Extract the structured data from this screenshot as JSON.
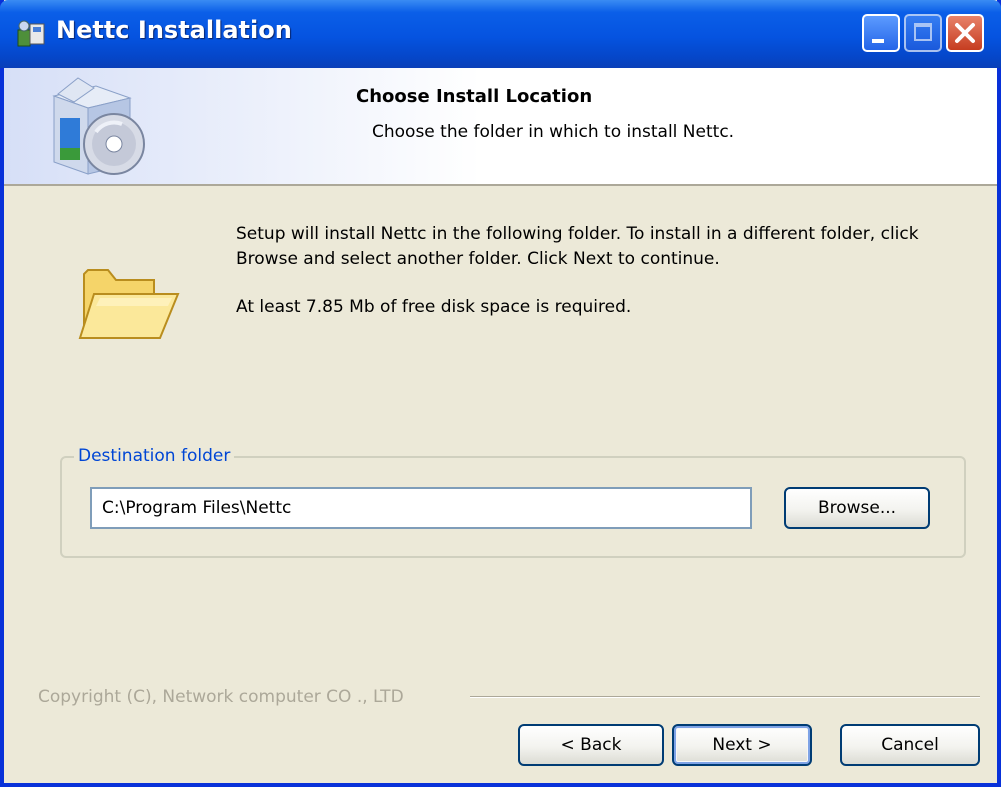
{
  "window": {
    "title": "Nettc Installation",
    "title_color": "#ffffff",
    "frame_color": "#0831d9",
    "controls": [
      "minimize-icon",
      "maximize-icon",
      "close-icon"
    ]
  },
  "header": {
    "title": "Choose Install Location",
    "subtitle": "Choose the folder in which to install Nettc."
  },
  "body": {
    "description": "Setup will install Nettc in the following folder. To install in a different folder, click Browse and select another folder. Click Next to continue.",
    "space_required": "At least 7.85 Mb of free disk space is required."
  },
  "destination": {
    "group_label": "Destination folder",
    "path": "C:\\Program Files\\Nettc",
    "browse_label": "Browse..."
  },
  "footer": {
    "copyright": "Copyright (C), Network computer CO ., LTD",
    "back_label": "< Back",
    "next_label": "Next >",
    "cancel_label": "Cancel"
  },
  "colors": {
    "dialog_background": "#ece9d8",
    "group_label": "#0046d5",
    "disabled_text": "#aca899"
  }
}
